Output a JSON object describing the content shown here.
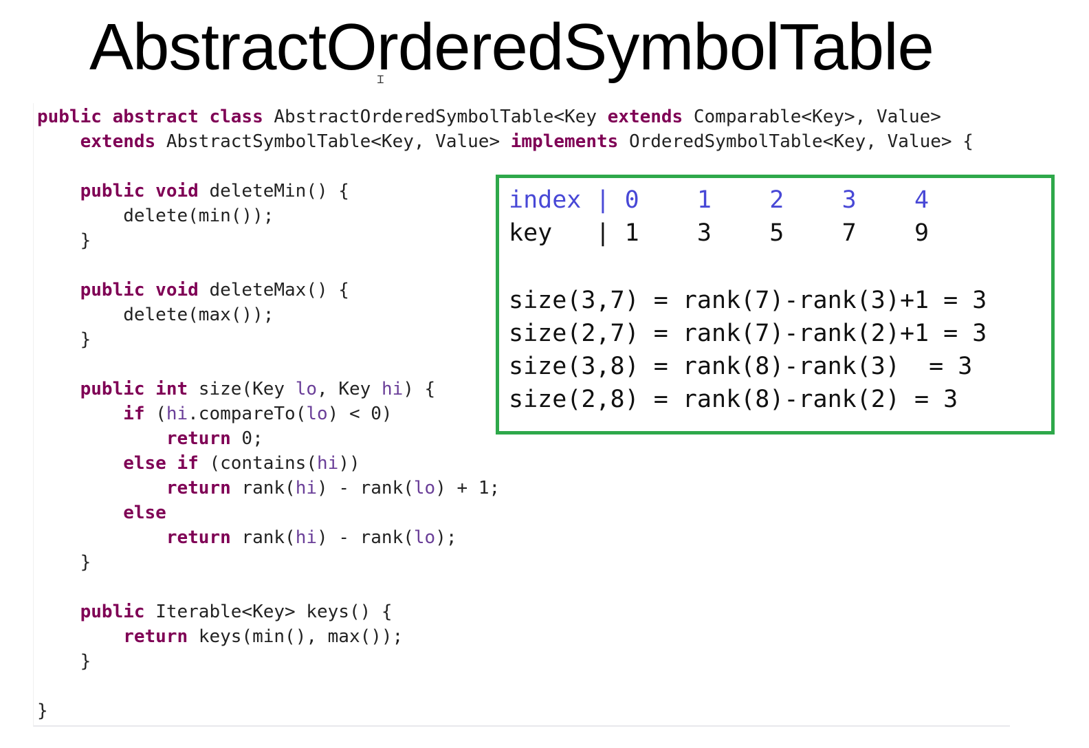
{
  "slide": {
    "title": "AbstractOrderedSymbolTable"
  },
  "code": {
    "lines": [
      [
        {
          "t": "public abstract class ",
          "c": "kw"
        },
        {
          "t": "AbstractOrderedSymbolTable<Key ",
          "c": "tok"
        },
        {
          "t": "extends ",
          "c": "kw"
        },
        {
          "t": "Comparable<Key>, Value>",
          "c": "tok"
        }
      ],
      [
        {
          "t": "    extends ",
          "c": "kw"
        },
        {
          "t": "AbstractSymbolTable<Key, Value> ",
          "c": "tok"
        },
        {
          "t": "implements ",
          "c": "kw"
        },
        {
          "t": "OrderedSymbolTable<Key, Value> {",
          "c": "tok"
        }
      ],
      [],
      [
        {
          "t": "    public void ",
          "c": "kw"
        },
        {
          "t": "deleteMin() {",
          "c": "tok"
        }
      ],
      [
        {
          "t": "        delete(min());",
          "c": "tok"
        }
      ],
      [
        {
          "t": "    }",
          "c": "tok"
        }
      ],
      [],
      [
        {
          "t": "    public void ",
          "c": "kw"
        },
        {
          "t": "deleteMax() {",
          "c": "tok"
        }
      ],
      [
        {
          "t": "        delete(max());",
          "c": "tok"
        }
      ],
      [
        {
          "t": "    }",
          "c": "tok"
        }
      ],
      [],
      [
        {
          "t": "    public int ",
          "c": "kw"
        },
        {
          "t": "size(Key ",
          "c": "tok"
        },
        {
          "t": "lo",
          "c": "fld"
        },
        {
          "t": ", Key ",
          "c": "tok"
        },
        {
          "t": "hi",
          "c": "fld"
        },
        {
          "t": ") {",
          "c": "tok"
        }
      ],
      [
        {
          "t": "        if ",
          "c": "kw"
        },
        {
          "t": "(",
          "c": "tok"
        },
        {
          "t": "hi",
          "c": "fld"
        },
        {
          "t": ".compareTo(",
          "c": "tok"
        },
        {
          "t": "lo",
          "c": "fld"
        },
        {
          "t": ") < 0)",
          "c": "tok"
        }
      ],
      [
        {
          "t": "            return ",
          "c": "kw"
        },
        {
          "t": "0;",
          "c": "tok"
        }
      ],
      [
        {
          "t": "        else if ",
          "c": "kw"
        },
        {
          "t": "(contains(",
          "c": "tok"
        },
        {
          "t": "hi",
          "c": "fld"
        },
        {
          "t": "))",
          "c": "tok"
        }
      ],
      [
        {
          "t": "            return ",
          "c": "kw"
        },
        {
          "t": "rank(",
          "c": "tok"
        },
        {
          "t": "hi",
          "c": "fld"
        },
        {
          "t": ") - rank(",
          "c": "tok"
        },
        {
          "t": "lo",
          "c": "fld"
        },
        {
          "t": ") + 1;",
          "c": "tok"
        }
      ],
      [
        {
          "t": "        else",
          "c": "kw"
        }
      ],
      [
        {
          "t": "            return ",
          "c": "kw"
        },
        {
          "t": "rank(",
          "c": "tok"
        },
        {
          "t": "hi",
          "c": "fld"
        },
        {
          "t": ") - rank(",
          "c": "tok"
        },
        {
          "t": "lo",
          "c": "fld"
        },
        {
          "t": ");",
          "c": "tok"
        }
      ],
      [
        {
          "t": "    }",
          "c": "tok"
        }
      ],
      [],
      [
        {
          "t": "    public ",
          "c": "kw"
        },
        {
          "t": "Iterable<Key> keys() {",
          "c": "tok"
        }
      ],
      [
        {
          "t": "        return ",
          "c": "kw"
        },
        {
          "t": "keys(min(), max());",
          "c": "tok"
        }
      ],
      [
        {
          "t": "    }",
          "c": "tok"
        }
      ],
      [],
      [
        {
          "t": "}",
          "c": "tok"
        }
      ]
    ]
  },
  "annotation_box": {
    "border_color": "#2ea84a",
    "index_row": "index | 0    1    2    3    4",
    "key_row": "key   | 1    3    5    7    9",
    "formulas": [
      "size(3,7) = rank(7)-rank(3)+1 = 3",
      "size(2,7) = rank(7)-rank(2)+1 = 3",
      "size(3,8) = rank(8)-rank(3)  = 3",
      "size(2,8) = rank(8)-rank(2) = 3"
    ]
  }
}
